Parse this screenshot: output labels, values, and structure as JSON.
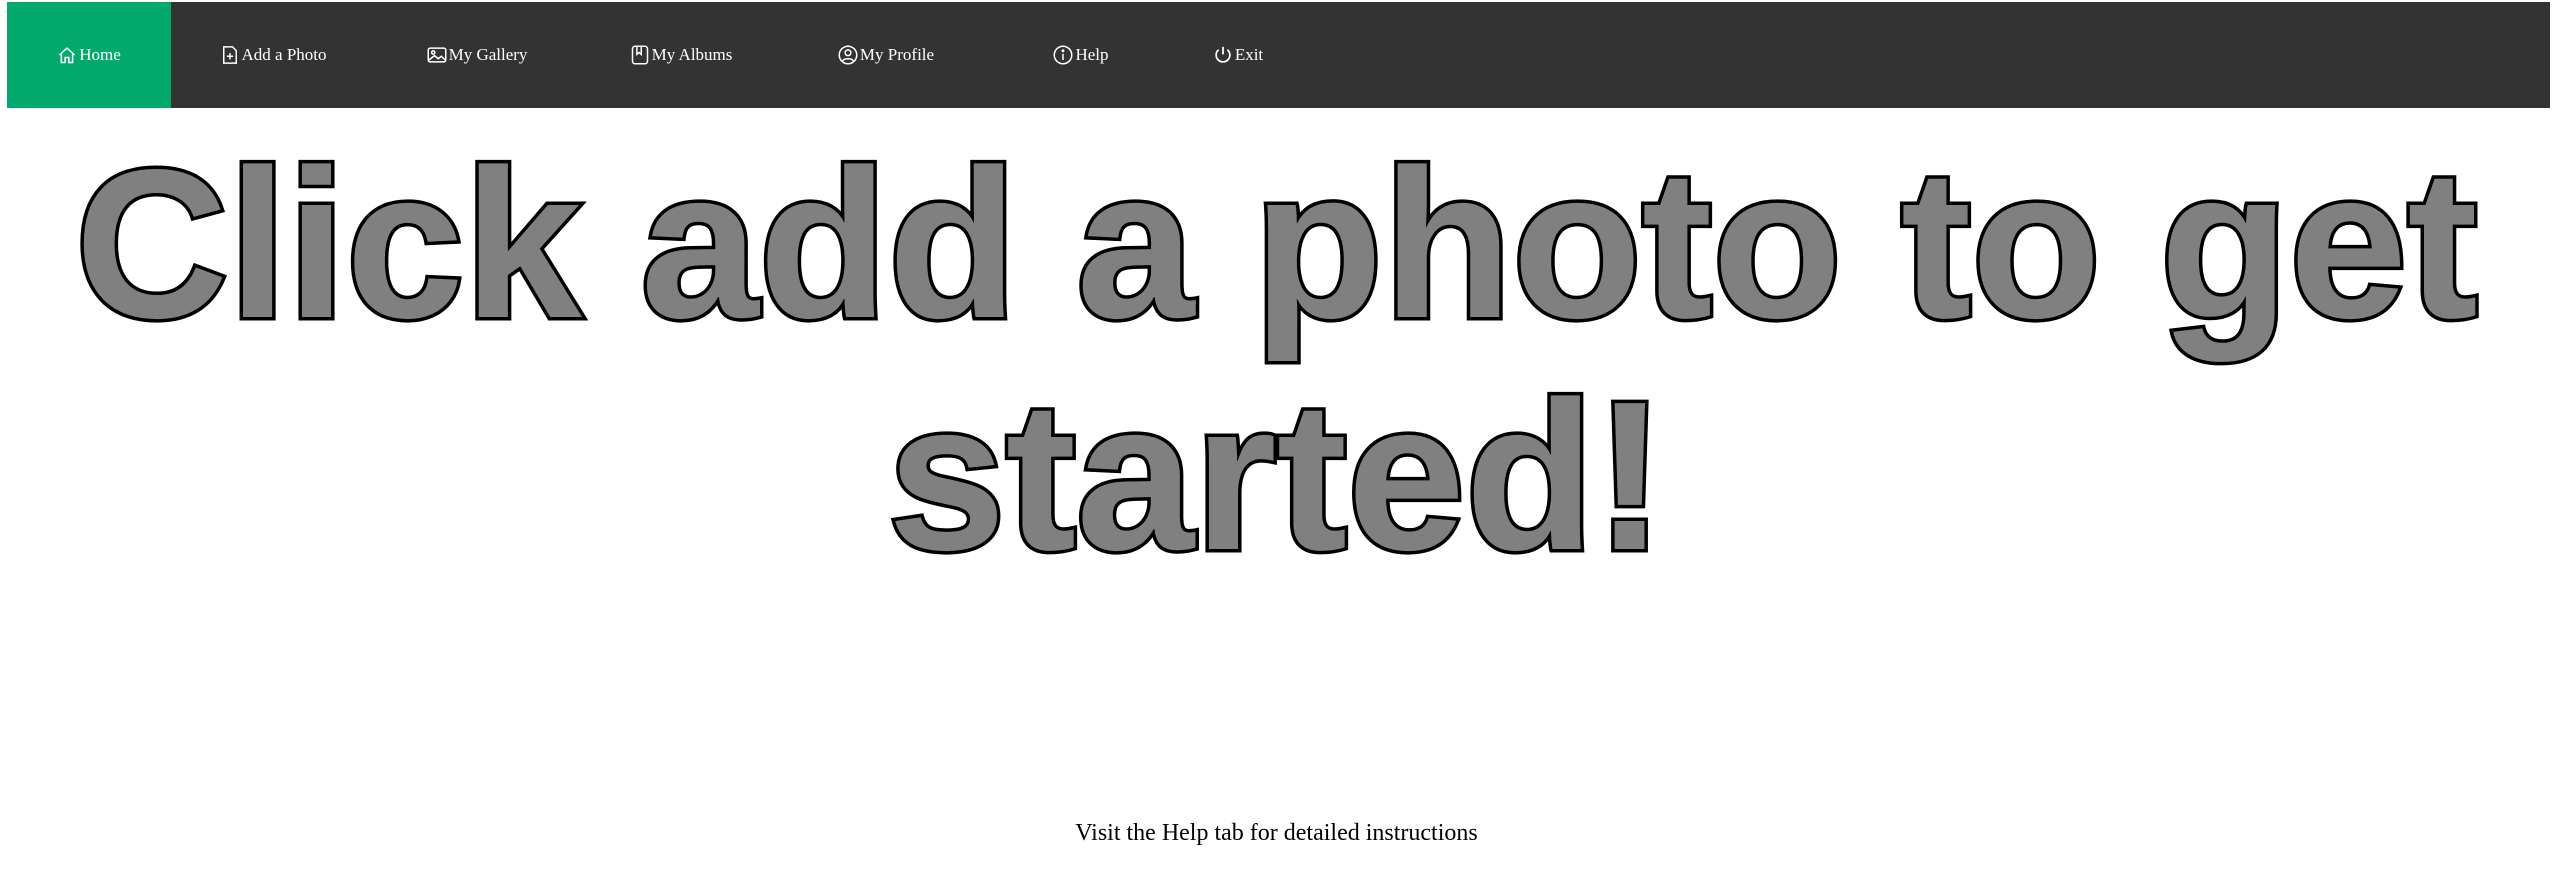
{
  "colors": {
    "navbar_bg": "#333333",
    "active_tab_bg": "#04aa6d",
    "nav_text": "#ffffff",
    "headline_fill": "#808080",
    "headline_stroke": "#000000"
  },
  "nav": {
    "items": [
      {
        "label": "Home",
        "icon": "home-icon",
        "active": true
      },
      {
        "label": "Add a Photo",
        "icon": "file-plus-icon",
        "active": false
      },
      {
        "label": "My Gallery",
        "icon": "image-icon",
        "active": false
      },
      {
        "label": "My Albums",
        "icon": "bookmark-book-icon",
        "active": false
      },
      {
        "label": "My Profile",
        "icon": "user-circle-icon",
        "active": false
      },
      {
        "label": "Help",
        "icon": "info-icon",
        "active": false
      },
      {
        "label": "Exit",
        "icon": "power-icon",
        "active": false
      }
    ]
  },
  "main": {
    "headline": "Click add a photo to get started!",
    "help_hint": "Visit the Help tab for detailed instructions"
  }
}
